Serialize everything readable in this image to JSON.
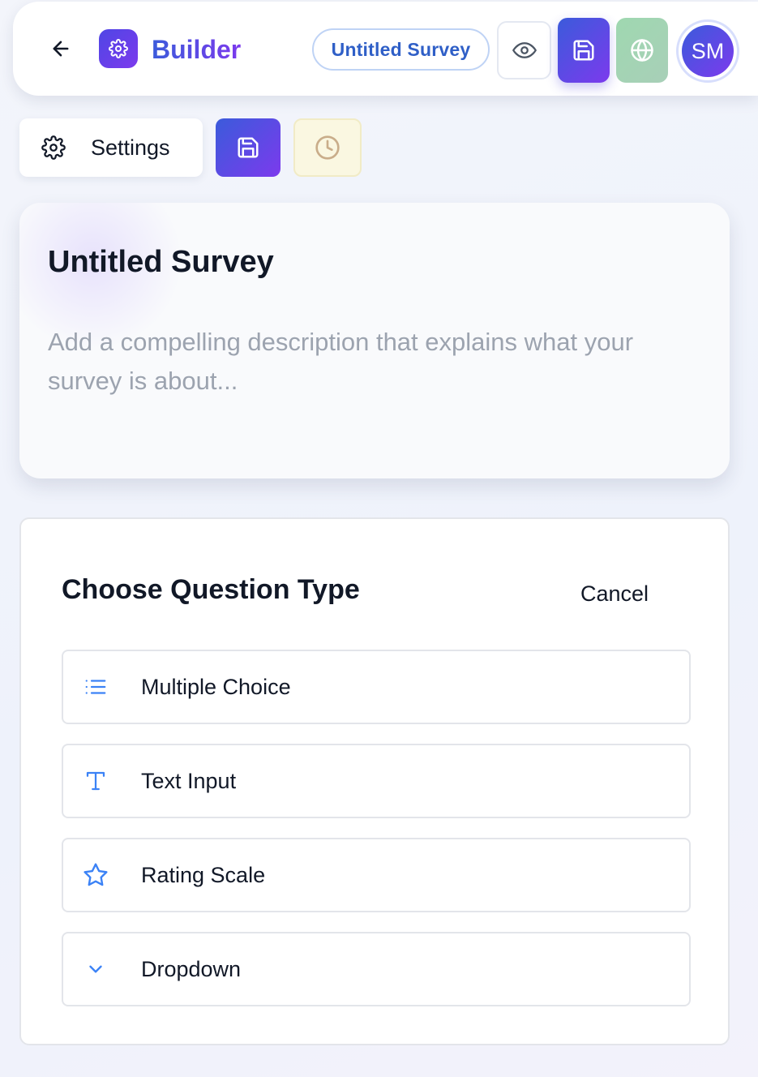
{
  "header": {
    "brand": "Builder",
    "survey_title_pill": "Untitled Survey",
    "avatar_initials": "SM"
  },
  "toolbar": {
    "settings_label": "Settings"
  },
  "survey": {
    "title": "Untitled Survey",
    "description_placeholder": "Add a compelling description that explains what your survey is about..."
  },
  "question_picker": {
    "title": "Choose Question Type",
    "cancel_label": "Cancel",
    "options": [
      {
        "label": "Multiple Choice",
        "icon": "list-icon"
      },
      {
        "label": "Text Input",
        "icon": "text-icon"
      },
      {
        "label": "Rating Scale",
        "icon": "star-icon"
      },
      {
        "label": "Dropdown",
        "icon": "chevron-down-icon"
      }
    ]
  },
  "colors": {
    "accent": "#4f46e5",
    "accent_end": "#7c3aed",
    "icon_blue": "#3b82f6",
    "publish_green": "#a3d5b5"
  }
}
